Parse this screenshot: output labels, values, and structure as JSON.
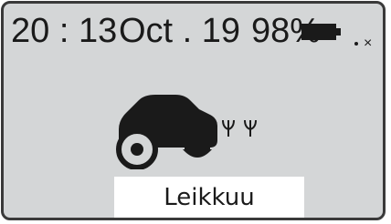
{
  "status_bar": {
    "time": "20 : 13",
    "date": "Oct . 19",
    "battery_percent": "98%",
    "signal_text": "×"
  },
  "icons": {
    "battery": "battery-icon",
    "signal": "signal-icon",
    "mower": "robot-mower-icon",
    "grass": "grass-icon"
  },
  "main": {
    "status_label": "Leikkuu"
  },
  "colors": {
    "screen_bg": "#d4d6d7",
    "ink": "#1a1a1a",
    "frame": "#3a3a3a"
  }
}
